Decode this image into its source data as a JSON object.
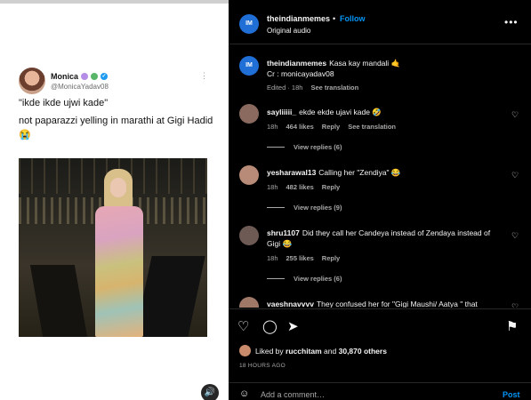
{
  "tweet": {
    "name": "Monica",
    "handle": "@MonicaYadav08",
    "text1": "\"ikde ikde ujwi kade\"",
    "text2": "not paparazzi yelling in marathi at Gigi Hadid 😭",
    "heart1_color": "#b48ee6",
    "heart2_color": "#59b56a",
    "more": "⋮"
  },
  "media": {
    "sound_icon": "🔊"
  },
  "header": {
    "avatar_text": "IM",
    "username": "theindianmemes",
    "dot": "•",
    "follow": "Follow",
    "audio": "Original audio",
    "more": "•••"
  },
  "caption": {
    "avatar_text": "IM",
    "username": "theindianmemes",
    "text": "Kasa kay mandali 🤙",
    "line2": "Cr : monicayadav08",
    "edited": "Edited · 18h",
    "see_translation": "See translation"
  },
  "comments": [
    {
      "username": "sayliiiii_",
      "text": "ekde ekde ujavi kade 🤣",
      "time": "18h",
      "likes": "464 likes",
      "reply": "Reply",
      "see_translation": "See translation",
      "view_replies": "View replies (6)",
      "avatar_color": "#8a6a5e"
    },
    {
      "username": "yesharawal13",
      "text": "Calling her \"Zendiya\" 😂",
      "time": "18h",
      "likes": "482 likes",
      "reply": "Reply",
      "view_replies": "View replies (9)",
      "avatar_color": "#b88a78"
    },
    {
      "username": "shru1107",
      "text": "Did they call her Candeya instead of Zendaya instead of Gigi 😂",
      "time": "18h",
      "likes": "255 likes",
      "reply": "Reply",
      "view_replies": "View replies (6)",
      "avatar_color": "#6e5a55"
    },
    {
      "username": "vaeshnavvvv",
      "text": "They confused her for \"Gigi Maushi/ Aatya \" that",
      "avatar_color": "#a07868"
    }
  ],
  "actions": {
    "like_icon": "♡",
    "comment_icon": "◯",
    "share_icon": "➤",
    "save_icon": "⚑",
    "liked_by_prefix": "Liked by",
    "liked_by_user": "rucchitam",
    "liked_and": "and",
    "liked_count": "30,870 others",
    "time_ago": "18 HOURS AGO"
  },
  "composer": {
    "emoji_icon": "☺",
    "placeholder": "Add a comment…",
    "post": "Post"
  }
}
